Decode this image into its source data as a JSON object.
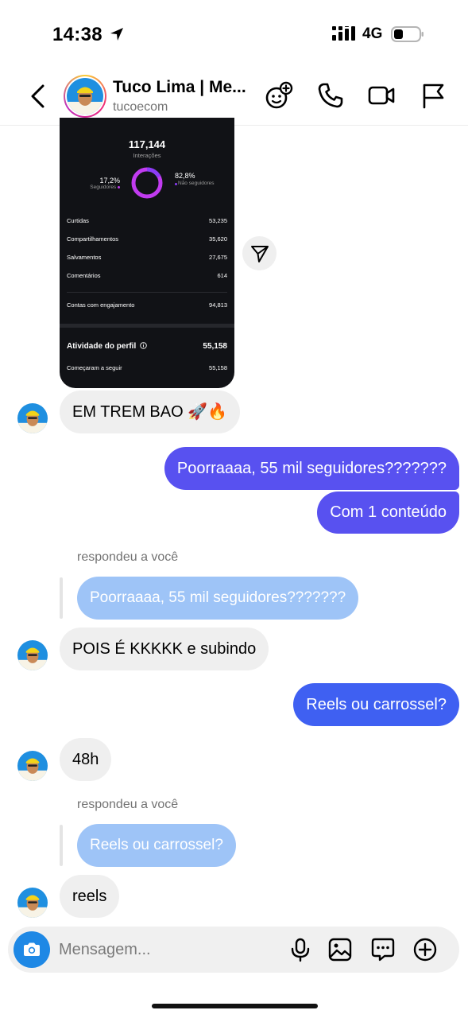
{
  "status_bar": {
    "time": "14:38",
    "network": "4G"
  },
  "header": {
    "contact_name": "Tuco Lima | Me...",
    "username": "tucoecom"
  },
  "shared_story": {
    "interactions_total": "117,144",
    "interactions_label": "Interações",
    "followers_pct": "17,2%",
    "followers_label": "Seguidores",
    "non_followers_pct": "82,8%",
    "non_followers_label": "Não seguidores",
    "metrics": [
      {
        "label": "Curtidas",
        "value": "53,235"
      },
      {
        "label": "Compartilhamentos",
        "value": "35,620"
      },
      {
        "label": "Salvamentos",
        "value": "27,675"
      },
      {
        "label": "Comentários",
        "value": "614"
      }
    ],
    "engagement_label": "Contas com engajamento",
    "engagement_value": "94,813",
    "profile_activity_label": "Atividade do perfil",
    "profile_activity_value": "55,158",
    "started_following_label": "Começaram a seguir",
    "started_following_value": "55,158",
    "followers_fraction": 0.172,
    "colors": {
      "followers": "#8b3cf6",
      "non_followers": "#c13bf0"
    }
  },
  "messages": [
    {
      "sender": "them",
      "text": "EM TREM BAO 🚀🔥"
    },
    {
      "sender": "me",
      "text": "Poorraaaa, 55 mil seguidores???????"
    },
    {
      "sender": "me",
      "text": "Com 1 conteúdo"
    },
    {
      "sender": "them",
      "reply_label": "respondeu a você",
      "quoted": "Poorraaaa, 55 mil seguidores???????",
      "text": "POIS É KKKKK e subindo"
    },
    {
      "sender": "me",
      "text": "Reels ou carrossel?"
    },
    {
      "sender": "them",
      "text": "48h"
    },
    {
      "sender": "them",
      "reply_label": "respondeu a você",
      "quoted": "Reels ou carrossel?",
      "text": "reels"
    }
  ],
  "composer": {
    "placeholder": "Mensagem..."
  },
  "colors": {
    "outgoing_bubble": "#5851f0",
    "incoming_bubble": "#efefef",
    "quoted_bubble": "#9ec4f7",
    "camera_button": "#1e88e5"
  }
}
